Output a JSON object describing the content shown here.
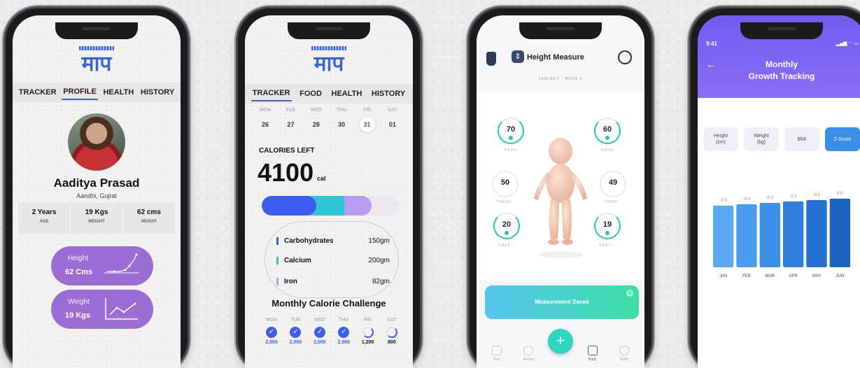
{
  "phone1": {
    "logo": "माप",
    "tabs": [
      "TRACKER",
      "PROFILE",
      "HEALTH",
      "HISTORY"
    ],
    "active_tab": "PROFILE",
    "profile": {
      "name": "Aaditya Prasad",
      "location": "Aandhi, Gujrat"
    },
    "stats": [
      {
        "value": "2 Years",
        "label": "AGE"
      },
      {
        "value": "19 Kgs",
        "label": "WEIGHT"
      },
      {
        "value": "62 cms",
        "label": "HEIGHT"
      }
    ],
    "cards": [
      {
        "label": "Height",
        "value": "62 Cms"
      },
      {
        "label": "Weight",
        "value": "19 Kgs"
      }
    ]
  },
  "phone2": {
    "logo": "माप",
    "tabs": [
      "TRACKER",
      "FOOD",
      "HEALTH",
      "HISTORY"
    ],
    "active_tab": "TRACKER",
    "days": [
      {
        "name": "MON",
        "date": "26"
      },
      {
        "name": "TUE",
        "date": "27"
      },
      {
        "name": "WED",
        "date": "28"
      },
      {
        "name": "THU",
        "date": "30"
      },
      {
        "name": "FRI",
        "date": "31"
      },
      {
        "name": "SAT",
        "date": "01"
      }
    ],
    "selected_date": "31",
    "calories_label": "CALORIES LEFT",
    "calories_value": "4100",
    "calories_unit": "cal",
    "macro_bar": {
      "blue": 0.4,
      "cyan": 0.2,
      "purple": 0.2
    },
    "nutrients": [
      {
        "name": "Carbohydrates",
        "amount": "150gm",
        "color": "#3d5cf0"
      },
      {
        "name": "Calcium",
        "amount": "200gm",
        "color": "#2fc6d4"
      },
      {
        "name": "Iron",
        "amount": "82gm",
        "color": "#b79ef2"
      }
    ],
    "challenge_title": "Monthly Calorie Challenge",
    "challenge": [
      {
        "day": "MON",
        "value": "2,000",
        "done": true
      },
      {
        "day": "TUE",
        "value": "2,000",
        "done": true
      },
      {
        "day": "WED",
        "value": "2,000",
        "done": true
      },
      {
        "day": "THU",
        "value": "2,000",
        "done": true
      },
      {
        "day": "FRI",
        "value": "1,200",
        "done": false
      },
      {
        "day": "SAT",
        "value": "800",
        "done": false
      }
    ]
  },
  "phone3": {
    "title": "Height Measure",
    "subtitle": "JANUARY · WEEK 4",
    "rings": [
      {
        "value": "70",
        "label": "HEAD",
        "accent": true
      },
      {
        "value": "60",
        "label": "HAND",
        "accent": true
      },
      {
        "value": "50",
        "label": "TORSO",
        "accent": false
      },
      {
        "value": "49",
        "label": "THIGH",
        "accent": false
      },
      {
        "value": "20",
        "label": "CALF",
        "accent": true
      },
      {
        "value": "19",
        "label": "FEET",
        "accent": true
      }
    ],
    "toast": "Measurement Saved",
    "nav": [
      "Plan",
      "Activity",
      "",
      "Body",
      "Notify"
    ],
    "active_nav": "Body"
  },
  "phone4": {
    "time": "9:41",
    "title_line1": "Monthly",
    "title_line2": "Growth Tracking",
    "metric_tabs": [
      {
        "label": "Height",
        "unit": "(cm)"
      },
      {
        "label": "Weight",
        "unit": "(kg)"
      },
      {
        "label": "BMI",
        "unit": ""
      },
      {
        "label": "Z-Score",
        "unit": ""
      }
    ],
    "active_metric": "Z-Score",
    "chart_data": {
      "type": "bar",
      "categories": [
        "JAN",
        "FEB",
        "MAR",
        "APR",
        "MAY",
        "JUN"
      ],
      "values": [
        -0.5,
        -0.4,
        -0.3,
        -0.2,
        -0.1,
        0.0
      ],
      "data_labels": [
        "-0.5",
        "-0.4",
        "-0.3",
        "-0.2",
        "-0.1",
        "0.0"
      ],
      "colors": [
        "#5aa8f0",
        "#4a9cec",
        "#3b8ee6",
        "#2f7fdc",
        "#2370d0",
        "#1c62bf"
      ],
      "title": "",
      "xlabel": "",
      "ylabel": "",
      "grid": false
    }
  }
}
